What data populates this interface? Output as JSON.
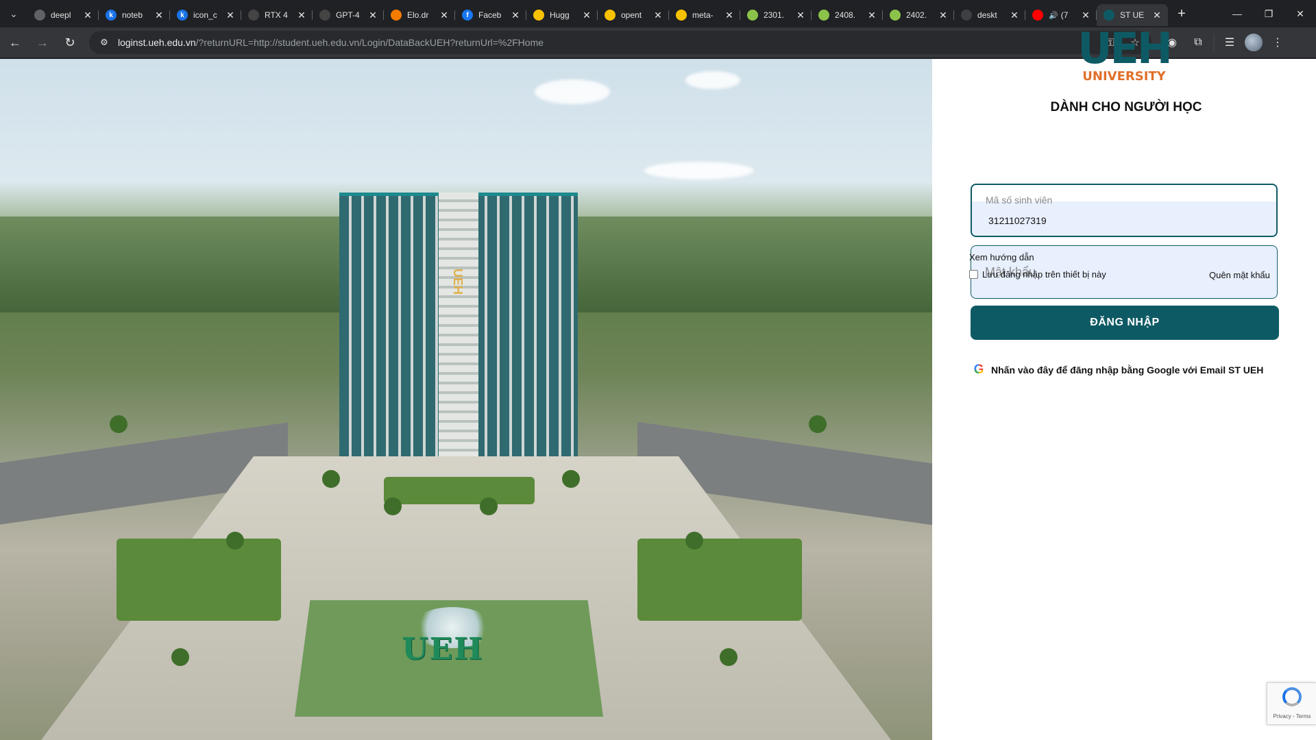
{
  "browser": {
    "tabs": [
      {
        "title": "deepl",
        "fav": "",
        "fav_color": "#5f6368"
      },
      {
        "title": "noteb",
        "fav": "k",
        "fav_color": "#1a73e8"
      },
      {
        "title": "icon_c",
        "fav": "k",
        "fav_color": "#1a73e8"
      },
      {
        "title": "RTX 4",
        "fav": "",
        "fav_color": "#444"
      },
      {
        "title": "GPT-4",
        "fav": "",
        "fav_color": "#444"
      },
      {
        "title": "Elo.dr",
        "fav": "",
        "fav_color": "#f57c00"
      },
      {
        "title": "Faceb",
        "fav": "f",
        "fav_color": "#1877f2"
      },
      {
        "title": "Hugg",
        "fav": "",
        "fav_color": "#f9c200"
      },
      {
        "title": "opent",
        "fav": "",
        "fav_color": "#f9c200"
      },
      {
        "title": "meta-",
        "fav": "",
        "fav_color": "#f9c200"
      },
      {
        "title": "2301.",
        "fav": "",
        "fav_color": "#8bc34a"
      },
      {
        "title": "2408.",
        "fav": "",
        "fav_color": "#8bc34a"
      },
      {
        "title": "2402.",
        "fav": "",
        "fav_color": "#8bc34a"
      },
      {
        "title": "deskt",
        "fav": "",
        "fav_color": "#3c4043"
      },
      {
        "title": "(7",
        "fav": "",
        "fav_color": "#ff0000"
      },
      {
        "title": "ST UE",
        "fav": "",
        "fav_color": "#0e5a64"
      }
    ],
    "url_host": "loginst.ueh.edu.vn",
    "url_rest": "/?returnURL=http://student.ueh.edu.vn/Login/DataBackUEH?returnUrl=%2FHome"
  },
  "login": {
    "logo_main": "UEH",
    "logo_sub": "UNIVERSITY",
    "heading": "DÀNH CHO NGƯỜI HỌC",
    "student_id_label": "Mã số sinh viên",
    "student_id_value": "31211027319",
    "password_placeholder": "Mật khẩu",
    "guide_link": "Xem hướng dẫn",
    "remember_label": "Lưu đăng nhập trên thiết bị này",
    "forgot_link": "Quên mật khẩu",
    "login_button": "ĐĂNG NHẬP",
    "google_login": "Nhấn vào đây để đăng nhập bằng Google với Email ST UEH"
  },
  "hero": {
    "tower_sign": "UEH",
    "ground_sign": "UEH"
  },
  "recaptcha": {
    "links": "Privacy - Terms"
  },
  "colors": {
    "brand": "#0e5a64",
    "accent": "#e0702a"
  }
}
